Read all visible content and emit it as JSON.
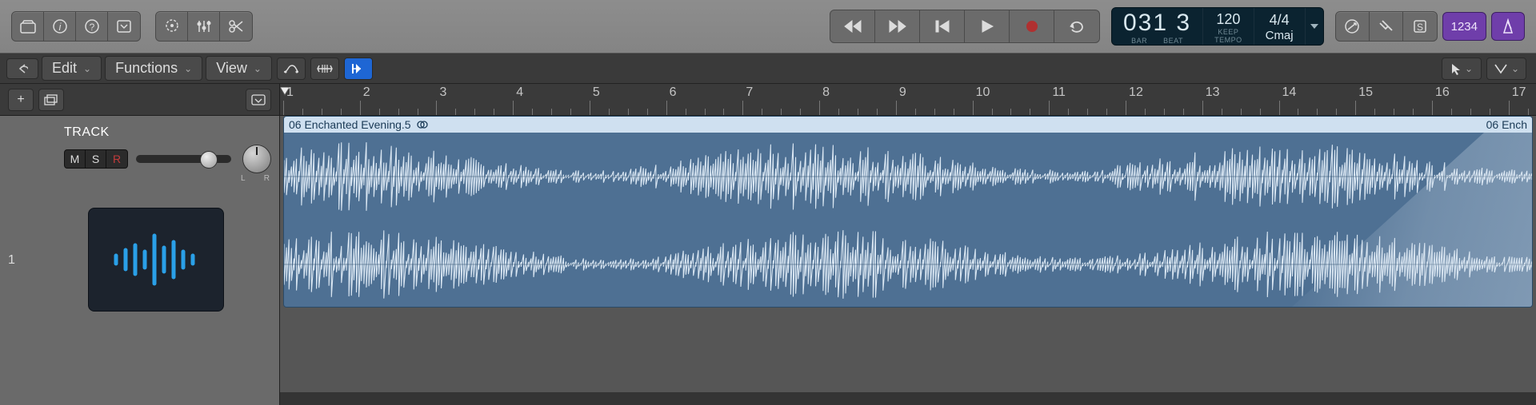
{
  "toolbar": {
    "left_icons": [
      "library-icon",
      "info-icon",
      "help-icon",
      "list-icon"
    ],
    "mid_icons": [
      "smart-controls-icon",
      "mixer-icon",
      "scissors-icon"
    ],
    "right_tool_icons": [
      "no-overlap-icon",
      "tuning-fork-icon",
      "solo-icon"
    ],
    "counter_text": "1234"
  },
  "transport": {
    "rewind": "◀◀",
    "forward": "▶▶",
    "to_start": "|◀",
    "play": "▶",
    "record": "●",
    "cycle": "↻"
  },
  "lcd": {
    "position_bars": "031",
    "position_beats": "3",
    "pos_label_bar": "BAR",
    "pos_label_beat": "BEAT",
    "tempo_value": "120",
    "tempo_sub": "KEEP",
    "tempo_label": "TEMPO",
    "sig_value": "4/4",
    "sig_key": "Cmaj"
  },
  "menubar": {
    "back_icon": "↶",
    "edit": "Edit",
    "functions": "Functions",
    "view": "View",
    "tools": [
      "automation-curve-icon",
      "flex-icon",
      "catch-icon"
    ],
    "right_tools": [
      "pointer-tool-icon",
      "marquee-tool-icon"
    ]
  },
  "track_add": {
    "add": "+",
    "add_stack": "⧉",
    "menu": "▾"
  },
  "ruler": {
    "numbers": [
      "1",
      "2",
      "3",
      "4",
      "5",
      "6",
      "7",
      "8",
      "9",
      "10",
      "11",
      "12",
      "13",
      "14",
      "15",
      "16",
      "17"
    ]
  },
  "track": {
    "number": "1",
    "title": "TRACK",
    "mute": "M",
    "solo": "S",
    "record": "R",
    "pan_left": "L",
    "pan_right": "R"
  },
  "region": {
    "name": "06 Enchanted Evening.5",
    "loop_badge": "⟲",
    "next_name": "06 Ench"
  }
}
